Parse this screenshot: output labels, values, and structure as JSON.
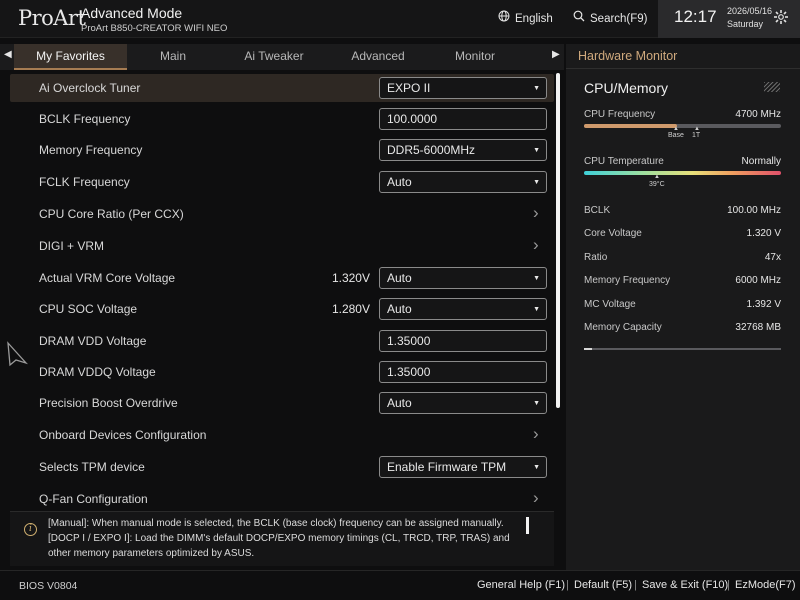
{
  "header": {
    "brand": "ProArt",
    "mode_title": "Advanced Mode",
    "board_name": "ProArt B850-CREATOR WIFI NEO",
    "language": "English",
    "search": "Search(F9)",
    "time": "12:17",
    "date": "2026/05/16",
    "day": "Saturday",
    "icons": {
      "language": "globe-icon",
      "search": "search-icon",
      "settings": "gear-icon"
    }
  },
  "tabs": [
    "My Favorites",
    "Main",
    "Ai Tweaker",
    "Advanced",
    "Monitor"
  ],
  "active_tab": "My Favorites",
  "settings": [
    {
      "label": "Ai Overclock Tuner",
      "type": "dropdown",
      "value": "EXPO II",
      "selected": true
    },
    {
      "label": "BCLK Frequency",
      "type": "input",
      "value": "100.0000"
    },
    {
      "label": "Memory Frequency",
      "type": "dropdown",
      "value": "DDR5-6000MHz"
    },
    {
      "label": "FCLK Frequency",
      "type": "dropdown",
      "value": "Auto"
    },
    {
      "label": "CPU Core Ratio (Per CCX)",
      "type": "submenu"
    },
    {
      "label": "DIGI + VRM",
      "type": "submenu"
    },
    {
      "label": "Actual VRM Core Voltage",
      "type": "dropdown",
      "reading": "1.320V",
      "value": "Auto"
    },
    {
      "label": "CPU SOC Voltage",
      "type": "dropdown",
      "reading": "1.280V",
      "value": "Auto"
    },
    {
      "label": "DRAM VDD Voltage",
      "type": "input",
      "value": "1.35000"
    },
    {
      "label": "DRAM VDDQ Voltage",
      "type": "input",
      "value": "1.35000"
    },
    {
      "label": "Precision Boost Overdrive",
      "type": "dropdown",
      "value": "Auto"
    },
    {
      "label": "Onboard Devices Configuration",
      "type": "submenu"
    },
    {
      "label": "Selects TPM device",
      "type": "dropdown",
      "value": "Enable Firmware TPM"
    },
    {
      "label": "Q-Fan Configuration",
      "type": "submenu"
    }
  ],
  "help": {
    "lines": [
      "[Manual]: When manual mode is selected, the BCLK (base clock) frequency can be assigned manually.",
      "[DOCP I / EXPO I]:  Load the DIMM's default DOCP/EXPO memory timings (CL, TRCD, TRP, TRAS) and",
      "other memory parameters optimized by ASUS."
    ]
  },
  "hardware_monitor": {
    "title": "Hardware Monitor",
    "section": "CPU/Memory",
    "cpu_frequency_label": "CPU Frequency",
    "cpu_frequency_value": "4700 MHz",
    "freq_bar_fill": 0.47,
    "freq_markers": [
      "Base",
      "1T"
    ],
    "cpu_temp_label": "CPU Temperature",
    "cpu_temp_status": "Normally",
    "cpu_temp_marker": "39°C",
    "stats": [
      {
        "label": "BCLK",
        "value": "100.00 MHz"
      },
      {
        "label": "Core Voltage",
        "value": "1.320 V"
      },
      {
        "label": "Ratio",
        "value": "47x"
      },
      {
        "label": "Memory Frequency",
        "value": "6000 MHz"
      },
      {
        "label": "MC Voltage",
        "value": "1.392 V"
      },
      {
        "label": "Memory Capacity",
        "value": "32768 MB"
      }
    ],
    "capacity_bar_fill": 0.04
  },
  "footer": {
    "bios_version": "BIOS V0804",
    "items": [
      "General Help (F1)",
      "Default (F5)",
      "Save & Exit (F10)",
      "EzMode(F7)"
    ]
  },
  "colors": {
    "accent": "#cfa97d",
    "selected_row": "#2e2823",
    "tab_active": "#38302a"
  }
}
